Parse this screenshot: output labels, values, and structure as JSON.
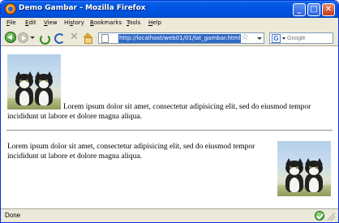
{
  "window": {
    "title": "Demo Gambar - Mozilla Firefox",
    "minimize_label": "_",
    "maximize_label": "□",
    "close_label": "✕"
  },
  "menu": {
    "items": [
      {
        "first": "F",
        "rest": "ile"
      },
      {
        "first": "E",
        "rest": "dit"
      },
      {
        "first": "V",
        "rest": "iew"
      },
      {
        "first": "",
        "rest": "Hi",
        "u": "s",
        "after": "tory"
      },
      {
        "first": "B",
        "rest": "ookmarks"
      },
      {
        "first": "T",
        "rest": "ools"
      },
      {
        "first": "H",
        "rest": "elp"
      }
    ]
  },
  "toolbar": {
    "back_icon": "back-arrow-icon",
    "forward_icon": "forward-arrow-icon",
    "reload_icon": "reload-icon",
    "stop_label": "✕",
    "home_icon": "home-icon"
  },
  "address": {
    "url": "http://localhost/web01/01/lat_gambar.html",
    "bookmark_star": "☆"
  },
  "search": {
    "engine_letter": "G",
    "placeholder": "Google"
  },
  "content": {
    "image_alt": "two kittens",
    "paragraph1_line1": "Lorem ipsum dolor sit amet, consectetur adipisicing elit, sed do eiusmod tempor",
    "paragraph1_line2": "incididunt ut labore et dolore magna aliqua.",
    "paragraph2": "Lorem ipsum dolor sit amet, consectetur adipisicing elit, sed do eiusmod tempor incididunt ut labore et dolore magna aliqua."
  },
  "status": {
    "text": "Done"
  },
  "colors": {
    "titlebar": "#0054e3",
    "chrome": "#ece9d8",
    "url_highlight": "#316ac5"
  }
}
